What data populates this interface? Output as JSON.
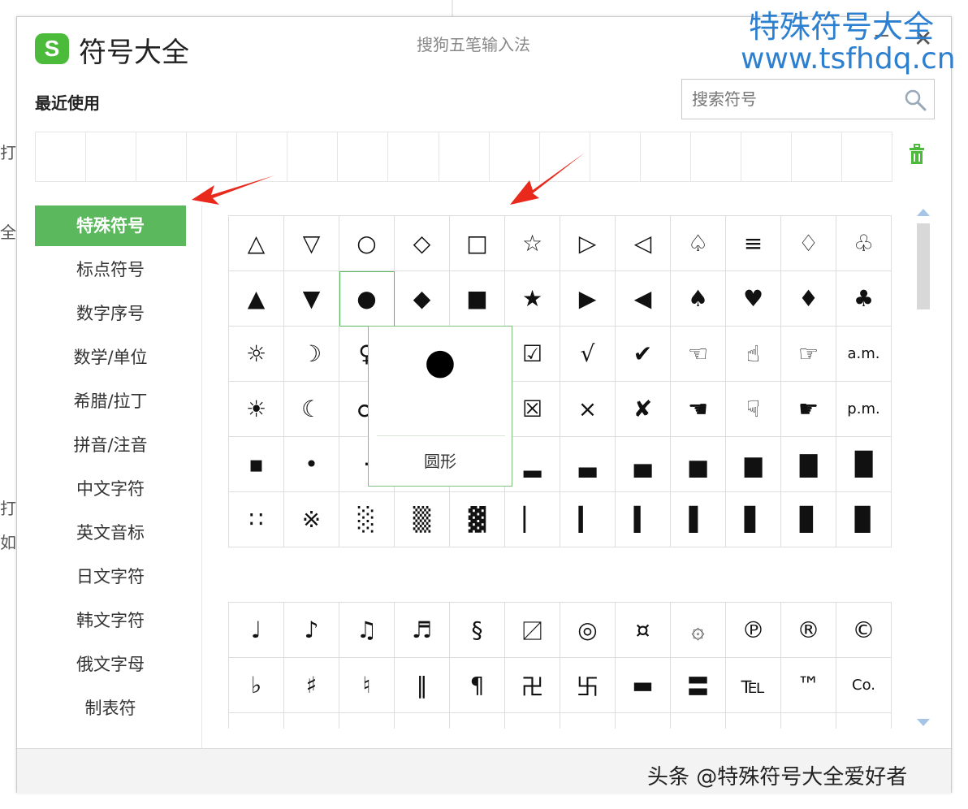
{
  "background": {
    "edge_chars": [
      "打",
      "全",
      "打",
      "如"
    ]
  },
  "window": {
    "logo_letter": "S",
    "title": "符号大全",
    "subtitle": "搜狗五笔输入法",
    "minimize_label": "−",
    "close_label": "✕"
  },
  "watermark": {
    "line1": "特殊符号大全",
    "line2": "www.tsfhdq.cn"
  },
  "recent": {
    "label": "最近使用",
    "slots": 17
  },
  "search": {
    "placeholder": "搜索符号"
  },
  "sidebar": {
    "items": [
      {
        "label": "特殊符号",
        "active": true
      },
      {
        "label": "标点符号"
      },
      {
        "label": "数字序号"
      },
      {
        "label": "数学/单位"
      },
      {
        "label": "希腊/拉丁"
      },
      {
        "label": "拼音/注音"
      },
      {
        "label": "中文字符"
      },
      {
        "label": "英文音标"
      },
      {
        "label": "日文字符"
      },
      {
        "label": "韩文字符"
      },
      {
        "label": "俄文字母"
      },
      {
        "label": "制表符"
      }
    ]
  },
  "grid1": [
    "△",
    "▽",
    "○",
    "◇",
    "□",
    "☆",
    "▷",
    "◁",
    "♤",
    "≡",
    "♢",
    "♧",
    "▲",
    "▼",
    "●",
    "◆",
    "■",
    "★",
    "▶",
    "◀",
    "♠",
    "♥",
    "♦",
    "♣",
    "☼",
    "☽",
    "♀",
    "",
    "",
    "☑",
    "√",
    "✔",
    "☜",
    "☝",
    "☞",
    "a.m.",
    "☀",
    "☾",
    "♂",
    "",
    "",
    "☒",
    "×",
    "✘",
    "☚",
    "☟",
    "☛",
    "p.m.",
    "▪",
    "•",
    "·",
    "",
    "",
    "▂",
    "▃",
    "▄",
    "▅",
    "▆",
    "▇",
    "█",
    "∷",
    "※",
    "░",
    "▒",
    "▓",
    "▏",
    "▎",
    "▍",
    "▌",
    "▋",
    "▊",
    "▉"
  ],
  "grid2": [
    "♩",
    "♪",
    "♫",
    "♬",
    "§",
    "〼",
    "◎",
    "¤",
    "۞",
    "℗",
    "®",
    "©",
    "♭",
    "♯",
    "♮",
    "‖",
    "¶",
    "卍",
    "卐",
    "▬",
    "〓",
    "℡",
    "™",
    "Co.",
    "",
    "",
    "",
    "",
    "",
    "",
    "",
    "",
    "",
    "",
    "",
    ""
  ],
  "tooltip": {
    "glyph": "●",
    "label": "圆形"
  },
  "footer": {
    "text": "头条 @特殊符号大全爱好者"
  },
  "colors": {
    "accent": "#5cb85c",
    "logo": "#4cbb3b",
    "arrow": "#e8291c",
    "watermark": "#2d7fd0"
  }
}
